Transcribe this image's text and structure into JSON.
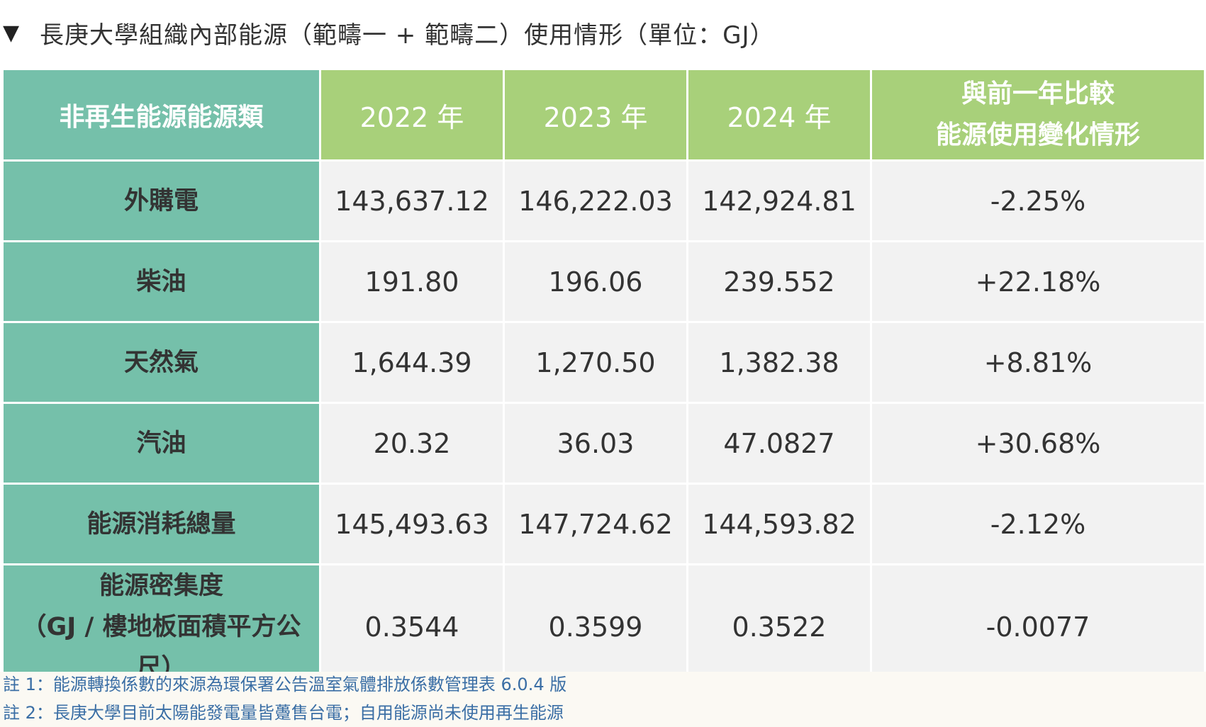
{
  "title": {
    "marker": "▼",
    "text": "長庚大學組織內部能源（範疇一 + 範疇二）使用情形（單位：GJ）"
  },
  "table": {
    "headers": {
      "category": "非再生能源能源類",
      "years": [
        "2022 年",
        "2023 年",
        "2024 年"
      ],
      "comparison_line1": "與前一年比較",
      "comparison_line2": "能源使用變化情形"
    },
    "rows": [
      {
        "label": "外購電",
        "label_line2": "",
        "values": [
          "143,637.12",
          "146,222.03",
          "142,924.81"
        ],
        "change": "-2.25%"
      },
      {
        "label": "柴油",
        "label_line2": "",
        "values": [
          "191.80",
          "196.06",
          "239.552"
        ],
        "change": "+22.18%"
      },
      {
        "label": "天然氣",
        "label_line2": "",
        "values": [
          "1,644.39",
          "1,270.50",
          "1,382.38"
        ],
        "change": "+8.81%"
      },
      {
        "label": "汽油",
        "label_line2": "",
        "values": [
          "20.32",
          "36.03",
          "47.0827"
        ],
        "change": "+30.68%"
      },
      {
        "label": "能源消耗總量",
        "label_line2": "",
        "values": [
          "145,493.63",
          "147,724.62",
          "144,593.82"
        ],
        "change": "-2.12%"
      },
      {
        "label": "能源密集度",
        "label_line2": "（GJ / 樓地板面積平方公尺）",
        "values": [
          "0.3544",
          "0.3599",
          "0.3522"
        ],
        "change": "-0.0077"
      }
    ]
  },
  "notes": [
    "註 1：能源轉換係數的來源為環保署公告溫室氣體排放係數管理表 6.0.4 版",
    "註 2：長庚大學目前太陽能發電量皆躉售台電；自用能源尚未使用再生能源"
  ],
  "colors": {
    "teal_header": "#75c0aa",
    "green_header": "#a8d07a",
    "cell_gray": "#f2f2f2",
    "note_text": "#3a6ea5"
  }
}
